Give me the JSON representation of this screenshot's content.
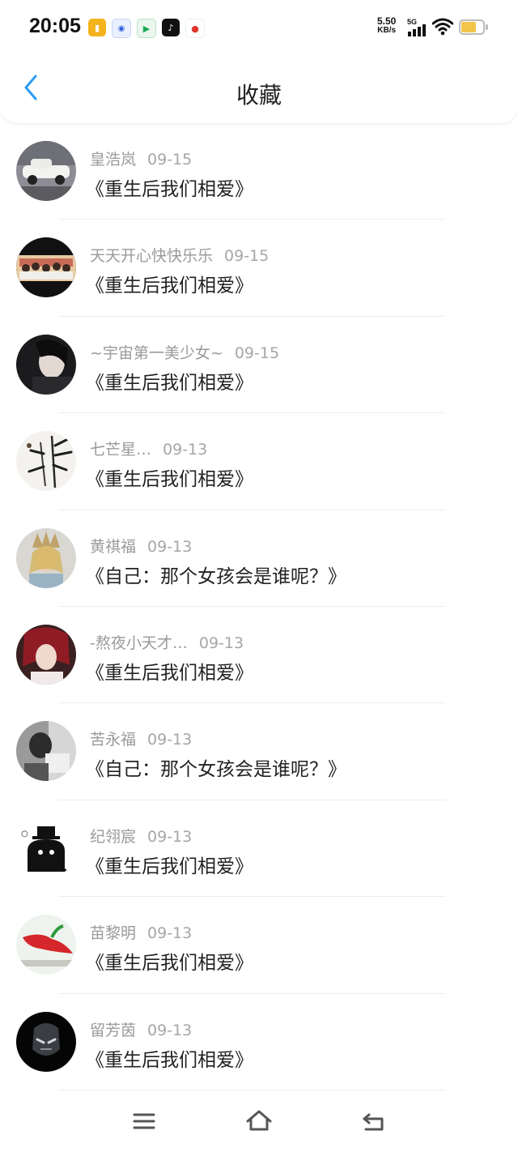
{
  "status_bar": {
    "time": "20:05",
    "net_speed": "5.50",
    "net_unit": "KB/s",
    "network": "5G",
    "notification_icons": [
      "notes-app-icon",
      "baidu-icon",
      "video-app-icon",
      "tiktok-icon",
      "map-app-icon"
    ],
    "battery_color": "#f3c44a"
  },
  "header": {
    "title": "收藏",
    "back_icon": "chevron-left-icon",
    "accent": "#2e9cf2"
  },
  "favorites": [
    {
      "user": "皇浩岚",
      "date": "09-15",
      "content": "《重生后我们相爱》",
      "avatar": "vintage-car"
    },
    {
      "user": "天天开心快快乐乐",
      "date": "09-15",
      "content": "《重生后我们相爱》",
      "avatar": "group-photo"
    },
    {
      "user": "~宇宙第一美少女~",
      "date": "09-15",
      "content": "《重生后我们相爱》",
      "avatar": "girl-portrait"
    },
    {
      "user": "七芒星…",
      "date": "09-13",
      "content": "《重生后我们相爱》",
      "avatar": "bamboo-painting"
    },
    {
      "user": "黄祺福",
      "date": "09-13",
      "content": "《自己：那个女孩会是谁呢？》",
      "avatar": "crowned-woman"
    },
    {
      "user": "-熬夜小天才…",
      "date": "09-13",
      "content": "《重生后我们相爱》",
      "avatar": "girl-red-hair"
    },
    {
      "user": "苦永福",
      "date": "09-13",
      "content": "《自己：那个女孩会是谁呢？》",
      "avatar": "bw-photo"
    },
    {
      "user": "纪翎宸",
      "date": "09-13",
      "content": "《重生后我们相爱》",
      "avatar": "black-cat"
    },
    {
      "user": "苗黎明",
      "date": "09-13",
      "content": "《重生后我们相爱》",
      "avatar": "red-pepper"
    },
    {
      "user": "留芳茵",
      "date": "09-13",
      "content": "《重生后我们相爱》",
      "avatar": "dark-robot"
    }
  ],
  "nav": {
    "menu_icon": "menu-icon",
    "home_icon": "home-icon",
    "back_icon": "back-icon"
  }
}
